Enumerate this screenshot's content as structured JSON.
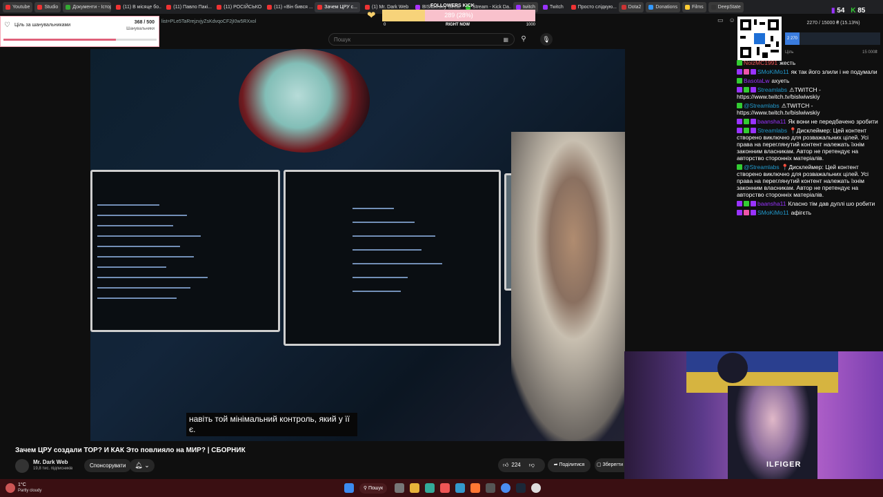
{
  "browser": {
    "tabs": [
      {
        "label": "Youtube",
        "type": "bookmark",
        "color": "#e33"
      },
      {
        "label": "Studio",
        "type": "bookmark",
        "color": "#e33"
      },
      {
        "label": "Документи - Історія",
        "type": "bookmark",
        "color": "#3a3"
      },
      {
        "label": "(11) В місяце бо...",
        "type": "tab",
        "color": "#e33"
      },
      {
        "label": "(11) Павло Пакі...",
        "type": "tab",
        "color": "#e33"
      },
      {
        "label": "(11) РОСІЙСЬКО...",
        "type": "tab",
        "color": "#e33"
      },
      {
        "label": "(11) «Він бився ...",
        "type": "tab",
        "color": "#e33"
      },
      {
        "label": "Зачем ЦРУ с...",
        "type": "active",
        "color": "#e33"
      },
      {
        "label": "(1) Mr. Dark Web",
        "type": "tab",
        "color": "#e33"
      },
      {
        "label": "BISlawiskiy Strea...",
        "type": "tab",
        "color": "#a3f"
      },
      {
        "label": "Stream - Kick Da...",
        "type": "tab",
        "color": "#3c3"
      },
      {
        "label": "twitch",
        "type": "bookmark",
        "color": "#93f"
      },
      {
        "label": "Twitch",
        "type": "tab",
        "color": "#93f"
      },
      {
        "label": "Просто слідкую...",
        "type": "tab",
        "color": "#e33"
      },
      {
        "label": "Dota2",
        "type": "bookmark",
        "color": "#c33"
      },
      {
        "label": "Donations",
        "type": "bookmark",
        "color": "#39f"
      },
      {
        "label": "Films",
        "type": "bookmark",
        "color": "#fc3"
      },
      {
        "label": "DeepState",
        "type": "bookmark",
        "color": "#333"
      }
    ],
    "url": "list=PLe5TaRrejzvjyZsKdvqoCF2jI0w5RXxol"
  },
  "youtube": {
    "search_placeholder": "Пошук",
    "subtitle": "навіть той мінімальний контроль, який у її є.",
    "video_title": "Зачем ЦРУ создали ТОР? И КАК Это повлияло на МИР? | СБОРНИК",
    "channel_name": "Mr. Dark Web",
    "channel_subs": "19,8 тис. підписників",
    "subscribe_label": "Спонсорувати",
    "like_count": "224",
    "share_label": "Поділитися",
    "save_label": "Зберегти"
  },
  "follower_goal": {
    "title": "Ціль за шанувальниками",
    "count": "368 / 500",
    "subtitle": "Шанувальники",
    "progress": 0.736
  },
  "kick_goal": {
    "label": "FOLLOWERS KICK",
    "value": "289 (28%)",
    "progress": 0.28,
    "min": "0",
    "mid": "RIGHT NOW",
    "max": "1000"
  },
  "overlay": {
    "twitch_count": "54",
    "kick_count": "85",
    "donation_text": "2270 / 15000 ₴ (15.13%)",
    "donation_current": "2 270",
    "donation_progress": 0.1513,
    "donation_left_label": "Ціль",
    "donation_max": "15 000₴"
  },
  "chat": [
    {
      "user": "NoizMC1991",
      "color": "#e55",
      "text": "жесть",
      "badges": [
        "#3c3"
      ]
    },
    {
      "user": "SMoKiMo11",
      "color": "#29c",
      "text": "як так його злили і не подумали",
      "badges": [
        "#93f",
        "#e5a",
        "#93f"
      ]
    },
    {
      "user": "BasotaLw",
      "color": "#93f",
      "text": "ахуеть",
      "badges": [
        "#3c3"
      ]
    },
    {
      "user": "Streamlabs",
      "color": "#29c",
      "text": "⚠TWITCH - https://www.twitch.tv/bislwiwskiy",
      "badges": [
        "#93f",
        "#3c3",
        "#93f"
      ]
    },
    {
      "user": "@Streamlabs",
      "color": "#29c",
      "text": "⚠TWITCH - https://www.twitch.tv/bislwiwskiy",
      "badges": [
        "#3c3"
      ]
    },
    {
      "user": "baansha11",
      "color": "#93f",
      "text": "Як вони не передбачено зробити",
      "badges": [
        "#93f",
        "#3c3",
        "#93f"
      ]
    },
    {
      "user": "Streamlabs",
      "color": "#29c",
      "text": "📍Дисклеймер: Цей контент створено виключно для розважальних цілей. Усі права на переглянутий контент належать їхнім законним власникам. Автор не претендує на авторство сторонніх матеріалів.",
      "badges": [
        "#93f",
        "#3c3",
        "#93f"
      ]
    },
    {
      "user": "@Streamlabs",
      "color": "#29c",
      "text": "📍Дисклеймер: Цей контент створено виключно для розважальних цілей. Усі права на переглянутий контент належать їхнім законним власникам. Автор не претендує на авторство сторонніх матеріалів.",
      "badges": [
        "#3c3"
      ]
    },
    {
      "user": "baansha11",
      "color": "#93f",
      "text": "Класно тім дав дуплі шо робити",
      "badges": [
        "#93f",
        "#3c3",
        "#93f"
      ]
    },
    {
      "user": "SMoKiMo11",
      "color": "#29c",
      "text": "афігєть",
      "badges": [
        "#93f",
        "#e5a",
        "#93f"
      ]
    }
  ],
  "webcam": {
    "shirt_text": "ILFIGER"
  },
  "taskbar": {
    "temperature": "1°C",
    "weather": "Partly cloudy",
    "search_label": "Пошук"
  }
}
